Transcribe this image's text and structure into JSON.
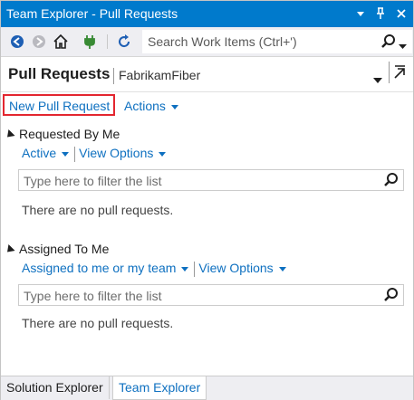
{
  "window": {
    "title": "Team Explorer - Pull Requests",
    "dropdown_glyph": "▾",
    "pin_glyph": "⊥",
    "close_glyph": "✕"
  },
  "toolbar": {
    "search_placeholder": "Search Work Items (Ctrl+')",
    "icons": [
      "back-icon",
      "forward-icon",
      "home-icon",
      "connect-plug-icon",
      "refresh-icon",
      "search-icon"
    ]
  },
  "header": {
    "title": "Pull Requests",
    "repo": "FabrikamFiber"
  },
  "actions": {
    "new_pull_request": "New Pull Request",
    "actions_label": "Actions"
  },
  "sections": [
    {
      "title": "Requested By Me",
      "filter_scope": "Active",
      "view_options": "View Options",
      "filter_placeholder": "Type here to filter the list",
      "empty_text": "There are no pull requests."
    },
    {
      "title": "Assigned To Me",
      "filter_scope": "Assigned to me or my team",
      "view_options": "View Options",
      "filter_placeholder": "Type here to filter the list",
      "empty_text": "There are no pull requests."
    }
  ],
  "tabs": [
    {
      "label": "Solution Explorer",
      "active": false
    },
    {
      "label": "Team Explorer",
      "active": true
    }
  ],
  "colors": {
    "title_bar": "#007acc",
    "link": "#0e70c0",
    "highlight_border": "#e3262f"
  }
}
